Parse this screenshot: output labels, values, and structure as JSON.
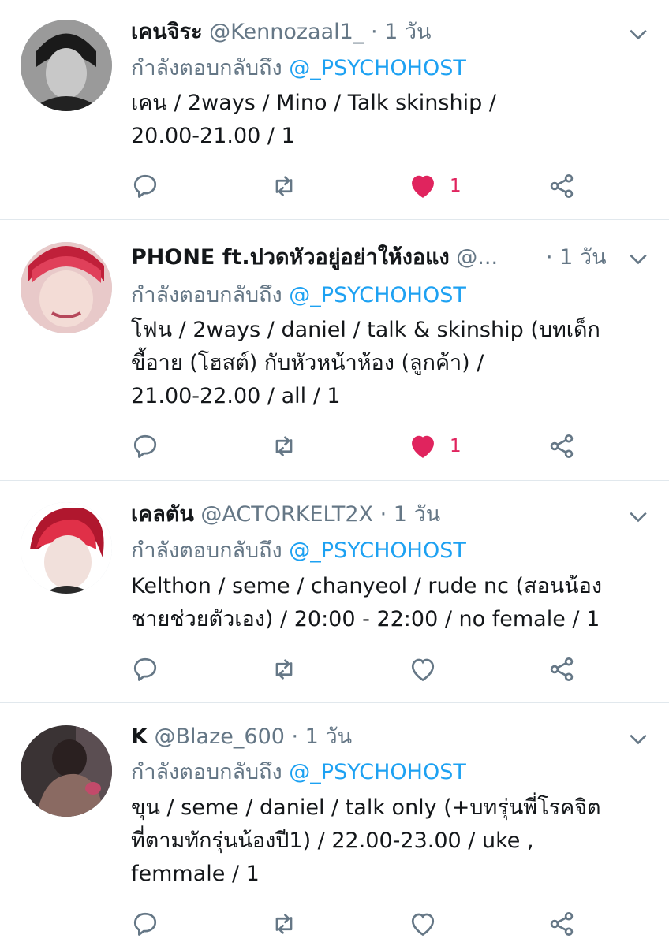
{
  "tweets": [
    {
      "name": "เคนจิระ",
      "handle": "@Kennozaal1_",
      "time": "· 1 วัน",
      "reply_prefix": "กำลังตอบกลับถึง",
      "reply_mention": "@_PSYCHOHOST",
      "lines": [
        "เคน / 2ways / Mino / Talk skinship /",
        "20.00-21.00 / 1"
      ],
      "liked": true,
      "like_count": "1"
    },
    {
      "name": "PHONE ft.ปวดหัวอยู่อย่าให้งอแง",
      "handle": "@...",
      "time": "· 1 วัน",
      "reply_prefix": "กำลังตอบกลับถึง",
      "reply_mention": "@_PSYCHOHOST",
      "lines": [
        "โฟน / 2ways / daniel / talk & skinship (บทเด็ก",
        "ขี้อาย (โฮสต์) กับหัวหน้าห้อง (ลูกค้า) /",
        "21.00-22.00 / all / 1"
      ],
      "liked": true,
      "like_count": "1"
    },
    {
      "name": "เคลตัน",
      "handle": "@ACTORKELT2X",
      "time": "· 1 วัน",
      "reply_prefix": "กำลังตอบกลับถึง",
      "reply_mention": "@_PSYCHOHOST",
      "lines": [
        "Kelthon / seme / chanyeol / rude nc (สอนน้อง",
        "ชายช่วยตัวเอง) / 20:00 - 22:00 / no female / 1"
      ],
      "liked": false,
      "like_count": ""
    },
    {
      "name": "K",
      "handle": "@Blaze_600",
      "time": "· 1 วัน",
      "reply_prefix": "กำลังตอบกลับถึง",
      "reply_mention": "@_PSYCHOHOST",
      "lines": [
        "ขุน / seme / daniel / talk only (+บทรุ่นพี่โรคจิต",
        "ที่ตามทักรุ่นน้องปี1) / 22.00-23.00 / uke ,",
        "femmale / 1"
      ],
      "liked": false,
      "like_count": ""
    }
  ],
  "colors": {
    "like_active": "#e0245e",
    "icon_gray": "#657786",
    "mention": "#1da1f2"
  },
  "icons": [
    "reply-icon",
    "retweet-icon",
    "like-icon",
    "share-icon",
    "chevron-down-icon"
  ]
}
